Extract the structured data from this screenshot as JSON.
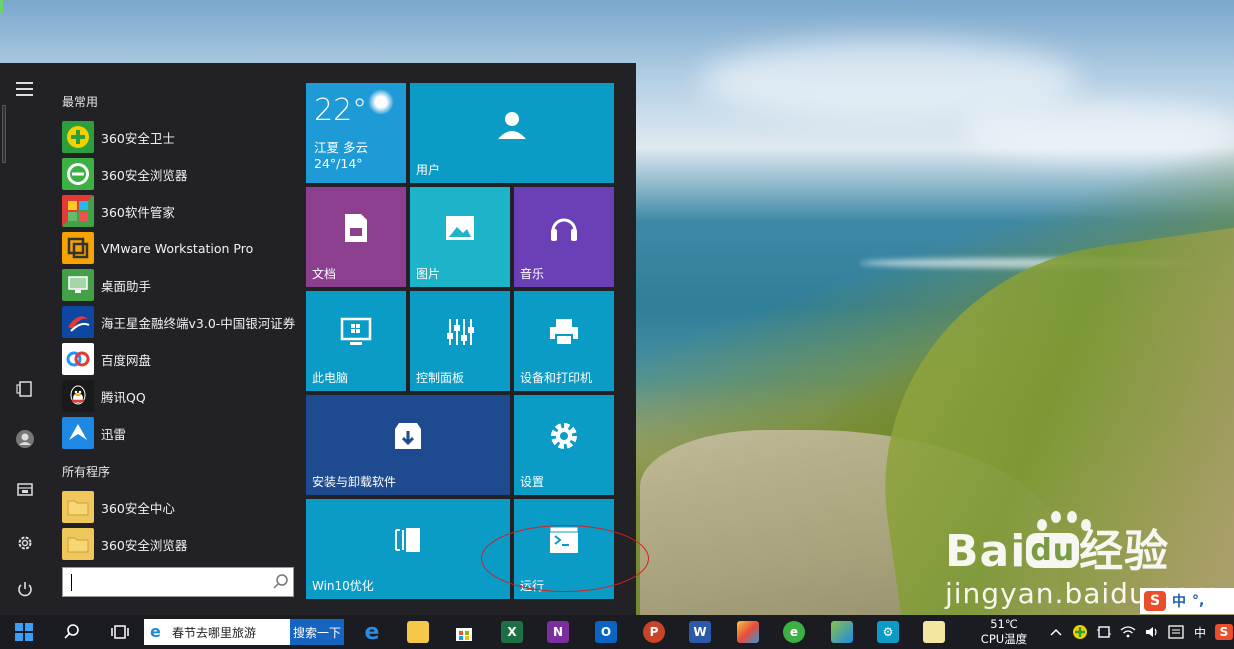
{
  "start_menu": {
    "most_used_label": "最常用",
    "all_programs_label": "所有程序",
    "most_used": [
      {
        "name": "360安全卫士",
        "icon": "360-safe-guard-icon",
        "color": "#2a9f3b"
      },
      {
        "name": "360安全浏览器",
        "icon": "360-browser-icon",
        "color": "#3cb043"
      },
      {
        "name": "360软件管家",
        "icon": "360-software-manager-icon",
        "color": "#e53935"
      },
      {
        "name": "VMware Workstation Pro",
        "icon": "vmware-icon",
        "color": "#f4a300"
      },
      {
        "name": "桌面助手",
        "icon": "desktop-assistant-icon",
        "color": "#43a047"
      },
      {
        "name": "海王星金融终端v3.0-中国银河证券",
        "icon": "neptune-finance-icon",
        "color": "#d32f2f"
      },
      {
        "name": "百度网盘",
        "icon": "baidu-netdisk-icon",
        "color": "#2196f3"
      },
      {
        "name": "腾讯QQ",
        "icon": "qq-icon",
        "color": "#111111"
      },
      {
        "name": "迅雷",
        "icon": "xunlei-icon",
        "color": "#1e88e5"
      }
    ],
    "all_programs": [
      {
        "name": "360安全中心",
        "icon": "folder-icon",
        "color": "#f0c75a"
      },
      {
        "name": "360安全浏览器",
        "icon": "folder-icon",
        "color": "#f0c75a"
      }
    ],
    "search_value": ""
  },
  "tiles": {
    "weather": {
      "temp": "22°",
      "city": "江夏  多云",
      "range": "24°/14°",
      "color": "#1e9ad6"
    },
    "user": {
      "label": "用户",
      "color": "#0a9cc7"
    },
    "documents": {
      "label": "文档",
      "color": "#8c3f8e"
    },
    "pictures": {
      "label": "图片",
      "color": "#1db4c9"
    },
    "music": {
      "label": "音乐",
      "color": "#6b3fb5"
    },
    "this_pc": {
      "label": "此电脑",
      "color": "#0a9cc7"
    },
    "control_panel": {
      "label": "控制面板",
      "color": "#0a9cc7"
    },
    "devices_printers": {
      "label": "设备和打印机",
      "color": "#0a9cc7"
    },
    "install_uninstall": {
      "label": "安装与卸载软件",
      "color": "#1e4a8f"
    },
    "settings": {
      "label": "设置",
      "color": "#0a9cc7"
    },
    "win10_opt": {
      "label": "Win10优化",
      "color": "#0a9cc7"
    },
    "run": {
      "label": "运行",
      "color": "#0a9cc7"
    }
  },
  "taskbar": {
    "address_text": "春节去哪里旅游",
    "search_label": "搜索一下",
    "cpu_temp": "51℃",
    "cpu_label": "CPU温度",
    "ime_label": "中"
  },
  "watermark": {
    "logo_left": "Bai",
    "logo_du": "du",
    "logo_right": "经验",
    "url": "jingyan.baidu.com"
  },
  "ime": {
    "zh": "中",
    "punct": "°,"
  }
}
